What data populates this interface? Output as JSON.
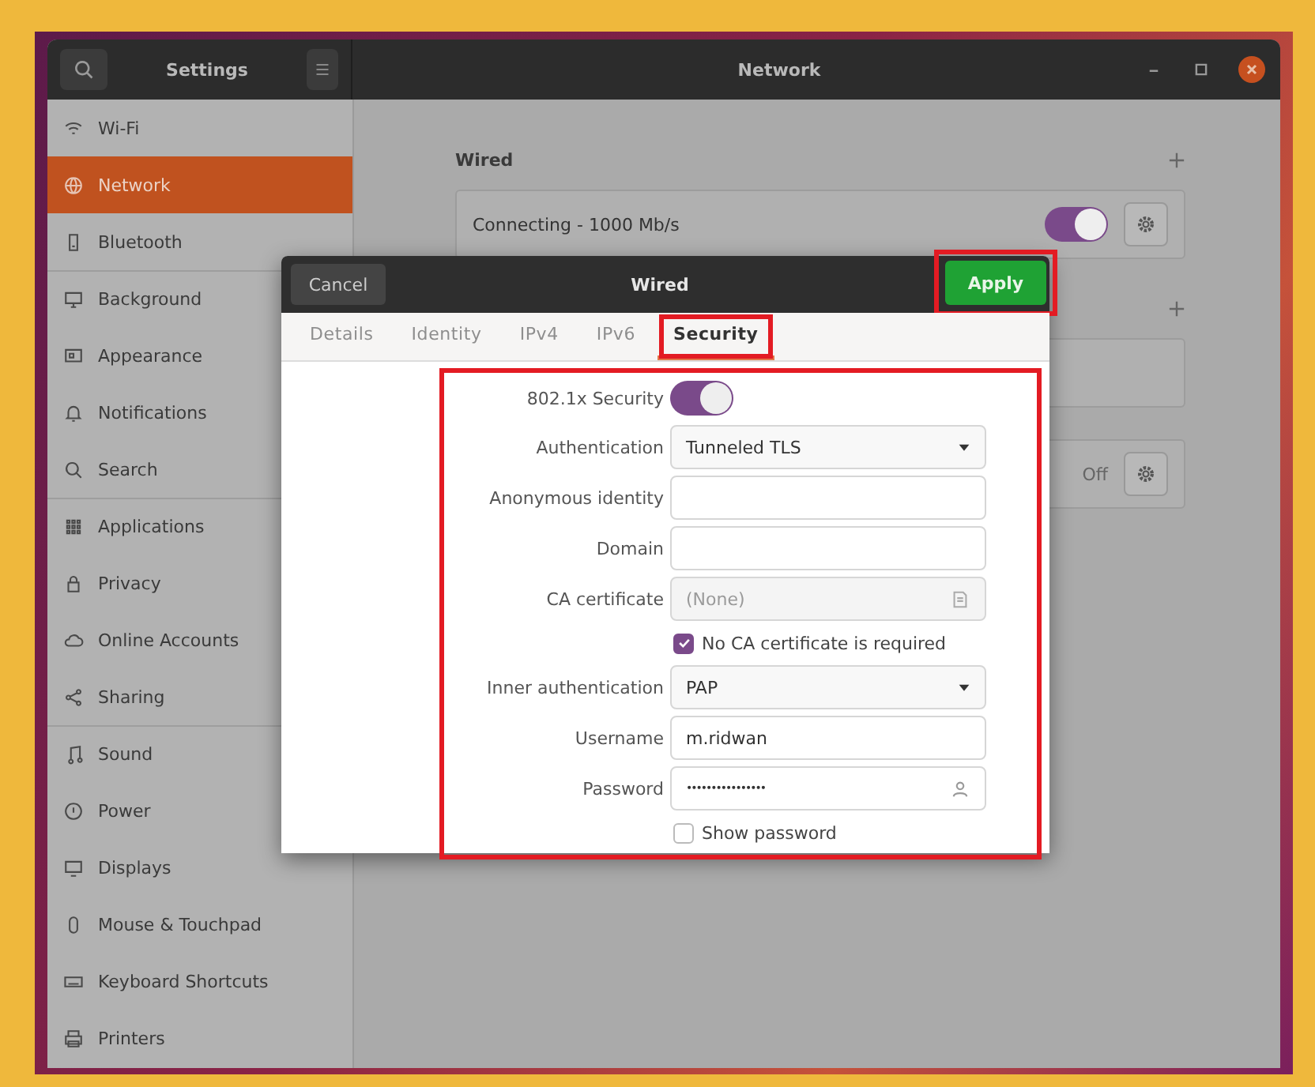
{
  "window": {
    "sidebar_title": "Settings",
    "title": "Network"
  },
  "sidebar": {
    "groups": [
      {
        "items": [
          {
            "label": "Wi-Fi",
            "selected": false
          },
          {
            "label": "Network",
            "selected": true
          },
          {
            "label": "Bluetooth",
            "selected": false
          }
        ]
      },
      {
        "items": [
          {
            "label": "Background",
            "selected": false
          },
          {
            "label": "Appearance",
            "selected": false
          },
          {
            "label": "Notifications",
            "selected": false
          },
          {
            "label": "Search",
            "selected": false
          }
        ]
      },
      {
        "items": [
          {
            "label": "Applications",
            "selected": false
          },
          {
            "label": "Privacy",
            "selected": false
          },
          {
            "label": "Online Accounts",
            "selected": false
          },
          {
            "label": "Sharing",
            "selected": false
          }
        ]
      },
      {
        "items": [
          {
            "label": "Sound",
            "selected": false
          },
          {
            "label": "Power",
            "selected": false
          },
          {
            "label": "Displays",
            "selected": false
          },
          {
            "label": "Mouse & Touchpad",
            "selected": false
          },
          {
            "label": "Keyboard Shortcuts",
            "selected": false
          },
          {
            "label": "Printers",
            "selected": false
          }
        ]
      }
    ]
  },
  "sections": [
    {
      "title": "Wired",
      "add": true,
      "cards": [
        {
          "kind": "connection",
          "label": "Connecting - 1000 Mb/s",
          "on": true
        }
      ]
    },
    {
      "add": true,
      "cards": [
        {
          "kind": "blank"
        }
      ]
    },
    {
      "cards": [
        {
          "kind": "status",
          "status": "Off"
        }
      ]
    }
  ],
  "dialog": {
    "title": "Wired",
    "cancel": "Cancel",
    "apply": {
      "label": "Apply",
      "highlighted": true
    },
    "tabs": [
      {
        "label": "Details",
        "selected": false,
        "highlighted": false
      },
      {
        "label": "Identity",
        "selected": false,
        "highlighted": false
      },
      {
        "label": "IPv4",
        "selected": false,
        "highlighted": false
      },
      {
        "label": "IPv6",
        "selected": false,
        "highlighted": false
      },
      {
        "label": "Security",
        "selected": true,
        "highlighted": true
      }
    ],
    "form": {
      "highlighted": true,
      "rows": [
        {
          "kind": "switch",
          "label": "802.1x Security",
          "on": true
        },
        {
          "kind": "dropdown",
          "label": "Authentication",
          "value": "Tunneled TLS"
        },
        {
          "kind": "text",
          "label": "Anonymous identity"
        },
        {
          "kind": "text",
          "label": "Domain"
        },
        {
          "kind": "file",
          "label": "CA certificate",
          "value": "(None)"
        },
        {
          "kind": "checkbox",
          "label": "No CA certificate is required",
          "checked": true
        },
        {
          "kind": "dropdown",
          "label": "Inner authentication",
          "value": "PAP"
        },
        {
          "kind": "text",
          "label": "Username",
          "value": "m.ridwan"
        },
        {
          "kind": "password",
          "label": "Password",
          "value": "••••••••••••••••"
        },
        {
          "kind": "checkbox",
          "label": "Show password",
          "checked": false
        }
      ]
    }
  }
}
